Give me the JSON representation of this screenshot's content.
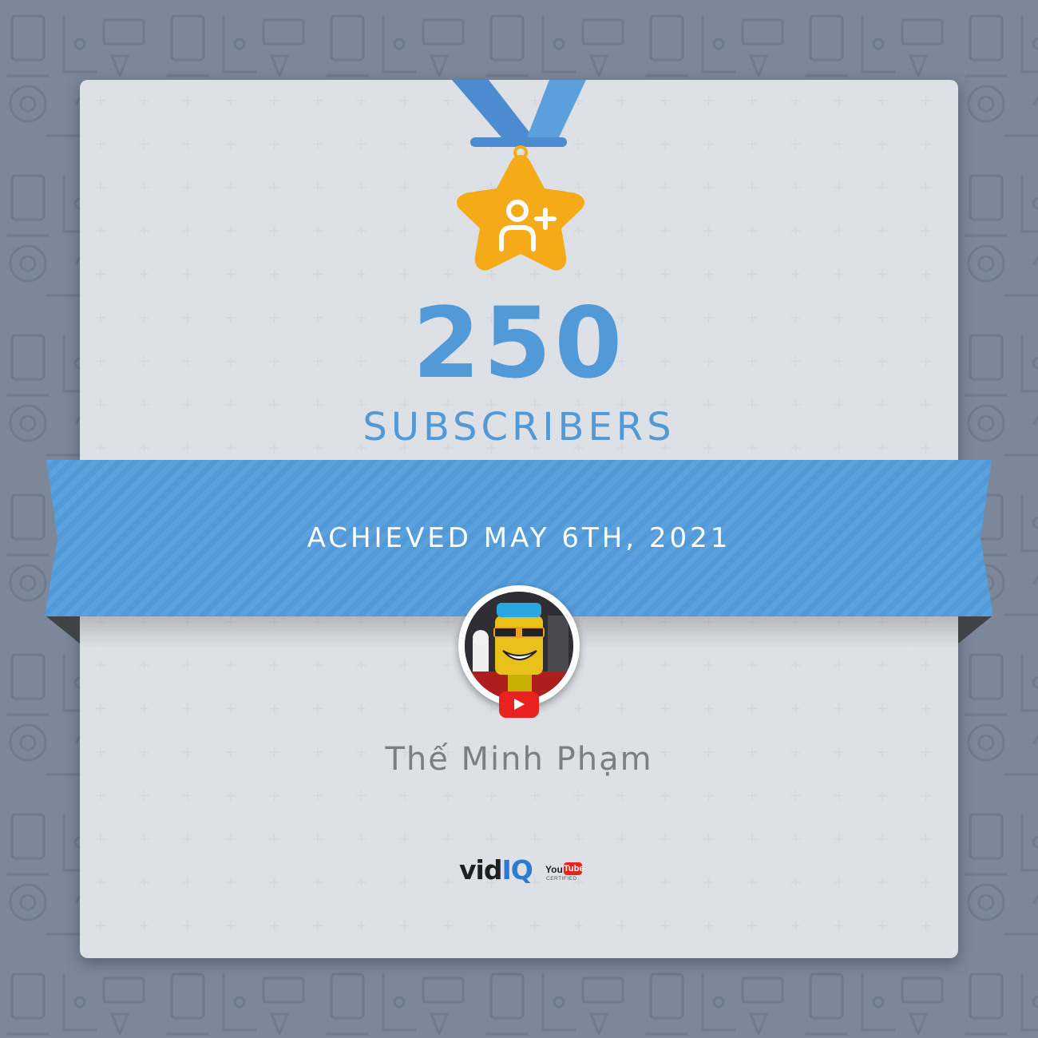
{
  "milestone": {
    "count": "250",
    "label": "SUBSCRIBERS",
    "achieved": "ACHIEVED MAY 6TH, 2021"
  },
  "channel": {
    "name": "Thế Minh Phạm",
    "platform_icon": "youtube-play-icon"
  },
  "branding": {
    "vid": "vid",
    "iq": "IQ",
    "yt_you": "You",
    "yt_tube": "Tube",
    "yt_certified": "CERTIFIED"
  },
  "colors": {
    "accent": "#5299d7",
    "medal_star": "#f5aa17",
    "background": "#7c8799",
    "card": "#f5f6f8",
    "youtube_red": "#e8231f"
  },
  "icons": {
    "medal": "star-medal-icon",
    "badge": "add-user-icon"
  }
}
